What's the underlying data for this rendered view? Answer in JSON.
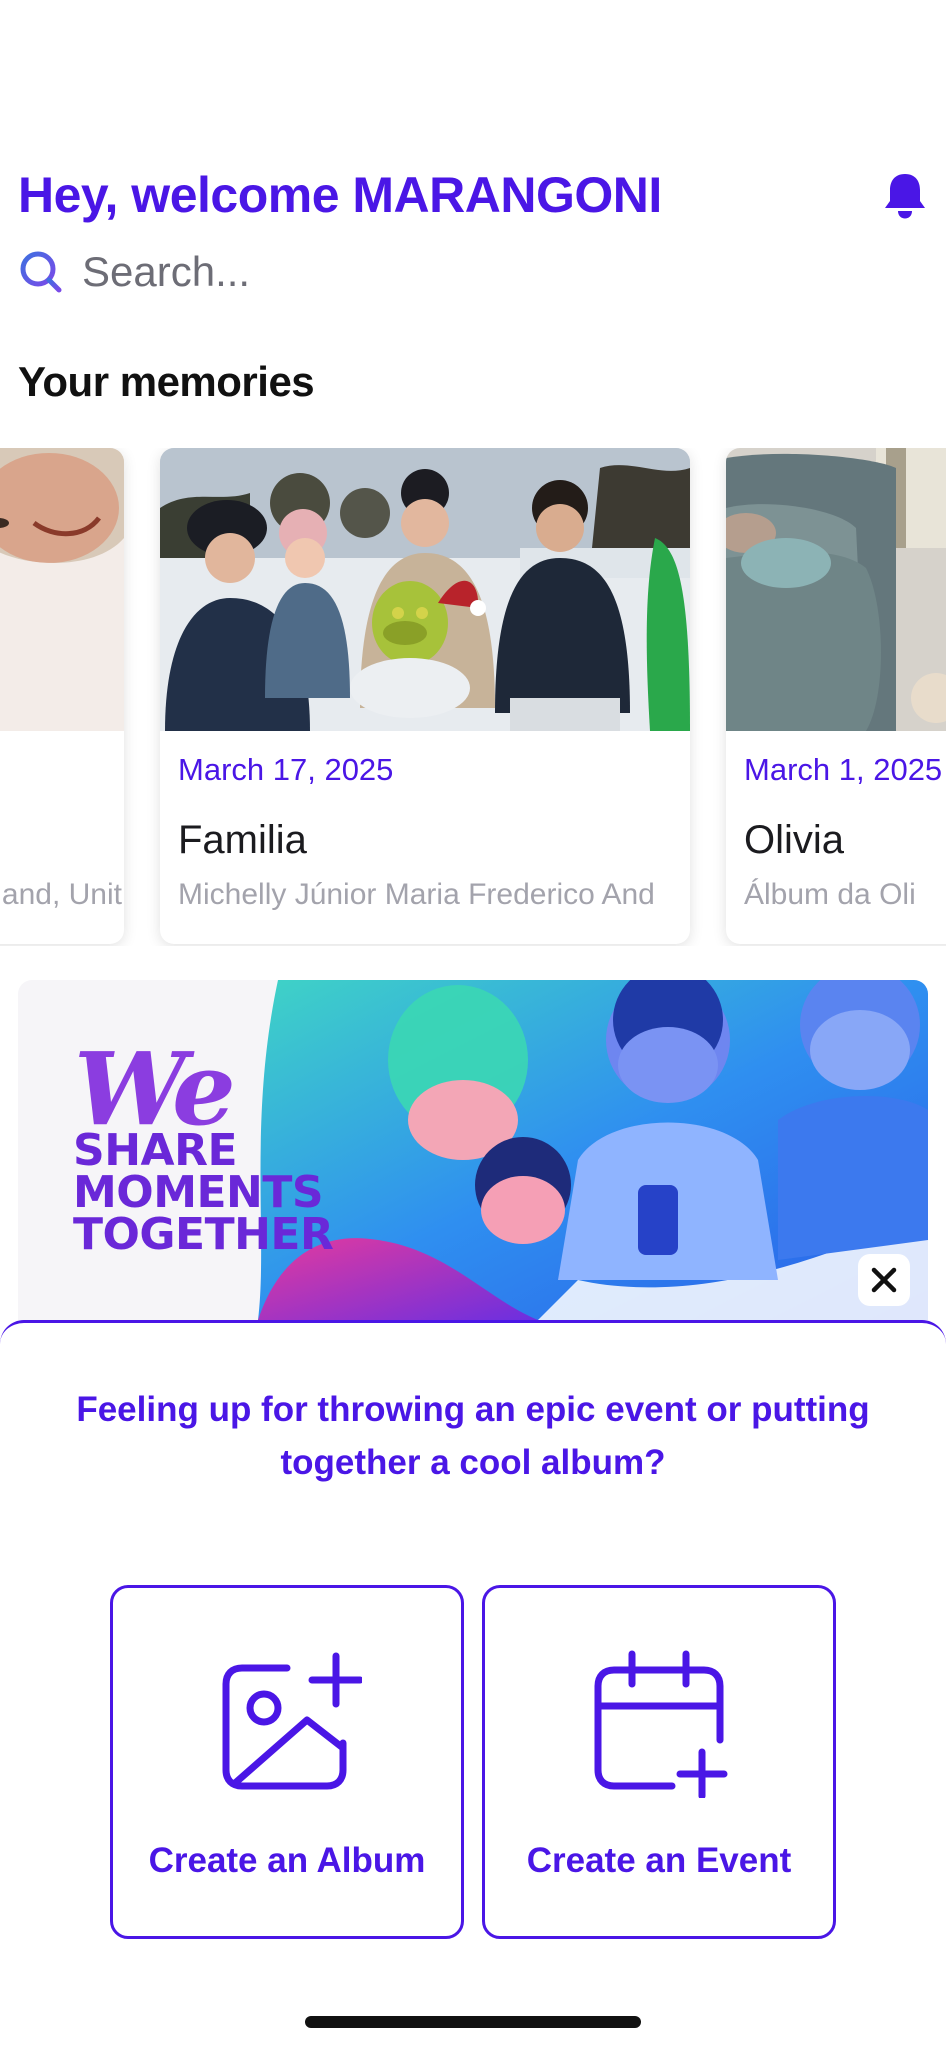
{
  "header": {
    "greeting": "Hey, welcome MARANGONI",
    "icon": "bell-icon"
  },
  "search": {
    "placeholder": "Search...",
    "icon": "search-icon"
  },
  "memories": {
    "title": "Your memories",
    "cards": [
      {
        "date": "",
        "name": "",
        "people": "and, Unit"
      },
      {
        "date": "March 17, 2025",
        "name": "Familia",
        "people": "Michelly Júnior Maria Frederico And"
      },
      {
        "date": "March 1, 2025",
        "name": "Olivia",
        "people": "Álbum da Oli"
      }
    ]
  },
  "banner": {
    "logo": "We",
    "tagline": [
      "SHARE",
      "MOMENTS",
      "TOGETHER"
    ],
    "close_icon": "close-icon"
  },
  "sheet": {
    "prompt": "Feeling up for throwing an epic event or putting together a cool album?",
    "actions": [
      {
        "label": "Create an Album",
        "icon": "add-photo-icon"
      },
      {
        "label": "Create an Event",
        "icon": "calendar-add-icon"
      }
    ]
  },
  "colors": {
    "accent": "#4a16e6",
    "muted": "#a3a3ac"
  }
}
